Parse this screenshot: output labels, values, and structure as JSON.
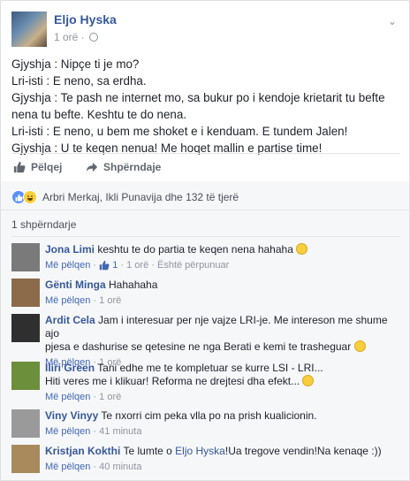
{
  "post": {
    "author": "Eljo Hyska",
    "time": "1 orë ·",
    "lines": [
      "Gjyshja : Nipçe ti je mo?",
      "Lri-isti : E neno, sa erdha.",
      "Gjyshja : Te pash ne internet mo, sa bukur po i kendoje krietarit tu befte",
      "nena tu befte. Keshtu te do nena.",
      "Lri-isti : E neno, u bem me shoket e i kenduam. E tundem Jalen!",
      "Gjyshja : U te keqen nenua! Me hoqet mallin e partise time!"
    ]
  },
  "actions": {
    "like": "Pëlqej",
    "share": "Shpërndaje"
  },
  "reactions": {
    "text": "Arbri Merkaj, Ikli Punavija dhe 132 të tjerë"
  },
  "shares": "1 shpërndarje",
  "comments": [
    {
      "name": "Jona Limi",
      "text": "keshtu te do partia te keqen nena hahaha",
      "like": "Më pëlqen",
      "likes": "1",
      "time": "1 orë",
      "extra": "Është përpunuar",
      "emoji": true,
      "avatar": "#7a7a7a"
    },
    {
      "name": "Gënti Minga",
      "text": "Hahahaha",
      "like": "Më pëlqen",
      "time": "1 orë",
      "avatar": "#8b6b4a"
    },
    {
      "name": "Ardit Cela",
      "text": "Jam i interesuar per nje vajze LRI-je. Me intereson me shume ajo",
      "text2": "pjesa e dashurise se qetesine ne nga Berati e kemi te trasheguar",
      "like": "Më pëlqen",
      "time": "1 orë",
      "emoji": true,
      "avatar": "#2f2f2f"
    },
    {
      "name": "Iliri Green",
      "text": "Tani edhe me te kompletuar se kurre LSI - LRI...",
      "text2": "Hiti veres me i klikuar! Reforma ne drejtesi dha efekt...",
      "like": "Më pëlqen",
      "time": "1 orë",
      "emoji": true,
      "avatar": "#6b8f3a"
    },
    {
      "name": "Viny Vinyy",
      "text": "Te nxorri cim peka vlla po na prish kualicionin.",
      "like": "Më pëlqen",
      "time": "41 minuta",
      "avatar": "#9a9a9a"
    },
    {
      "name": "Kristjan Kokthi",
      "text_pre": "Te lumte o ",
      "mention": "Eljo Hyska",
      "text_post": "!Ua tregove vendin!Na kenaqe :))",
      "like": "Më pëlqen",
      "time": "40 minuta",
      "avatar": "#a88a5c"
    }
  ]
}
